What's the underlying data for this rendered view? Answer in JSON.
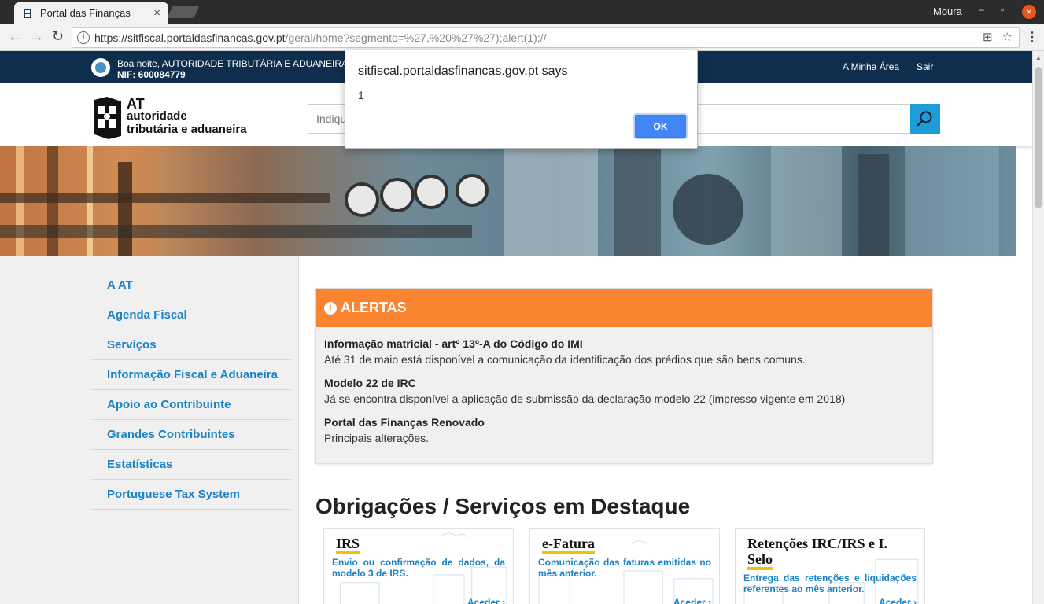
{
  "browser": {
    "tab_title": "Portal das Finanças",
    "user": "Moura",
    "url_host": "https://sitfiscal.portaldasfinancas.gov.pt",
    "url_path": "/geral/home?segmento=%27,%20%27%27);alert(1);//"
  },
  "topbar": {
    "greeting": "Boa noite, AUTORIDADE TRIBUTÁRIA E ADUANEIRA",
    "nif": "NIF: 600084779",
    "links": [
      "A Minha Área",
      "Sair"
    ]
  },
  "header": {
    "logo_at": "AT",
    "logo_line1": "autoridade",
    "logo_line2": "tributária e aduaneira",
    "search_placeholder": "Indique"
  },
  "nav": [
    "A AT",
    "Agenda Fiscal",
    "Serviços",
    "Informação Fiscal e Aduaneira",
    "Apoio ao Contribuinte",
    "Grandes Contribuintes",
    "Estatísticas",
    "Portuguese Tax System"
  ],
  "alerts": {
    "title": "ALERTAS",
    "items": [
      {
        "title": "Informação matricial - artº 13º-A do Código do IMI",
        "text": "Até 31 de maio está disponível a comunicação da identificação dos prédios que são bens comuns."
      },
      {
        "title": "Modelo 22 de IRC",
        "text": "Já se encontra disponível a aplicação de submissão da declaração modelo 22 (impresso vigente em 2018)"
      },
      {
        "title": "Portal das Finanças Renovado",
        "text": "Principais alterações."
      }
    ]
  },
  "featured": {
    "title": "Obrigações / Serviços em Destaque",
    "cards": [
      {
        "title": "IRS",
        "desc": "Envio ou confirmação de dados, da modelo 3 de IRS.",
        "link": "Aceder"
      },
      {
        "title": "e-Fatura",
        "desc": "Comunicação das faturas emitidas no mês anterior.",
        "link": "Aceder"
      },
      {
        "title_line1": "Retenções IRC/IRS e I.",
        "title_line2": "Selo",
        "desc": "Entrega das retenções e liquidações referentes ao mês anterior.",
        "link": "Aceder"
      }
    ]
  },
  "dialog": {
    "title": "sitfiscal.portaldasfinancas.gov.pt says",
    "message": "1",
    "ok": "OK"
  },
  "colors": {
    "topbar": "#0f2e4e",
    "accent_blue": "#1a83c6",
    "alert_orange": "#fb8430",
    "card_underline": "#f2c200",
    "dialog_button": "#4285f4"
  }
}
